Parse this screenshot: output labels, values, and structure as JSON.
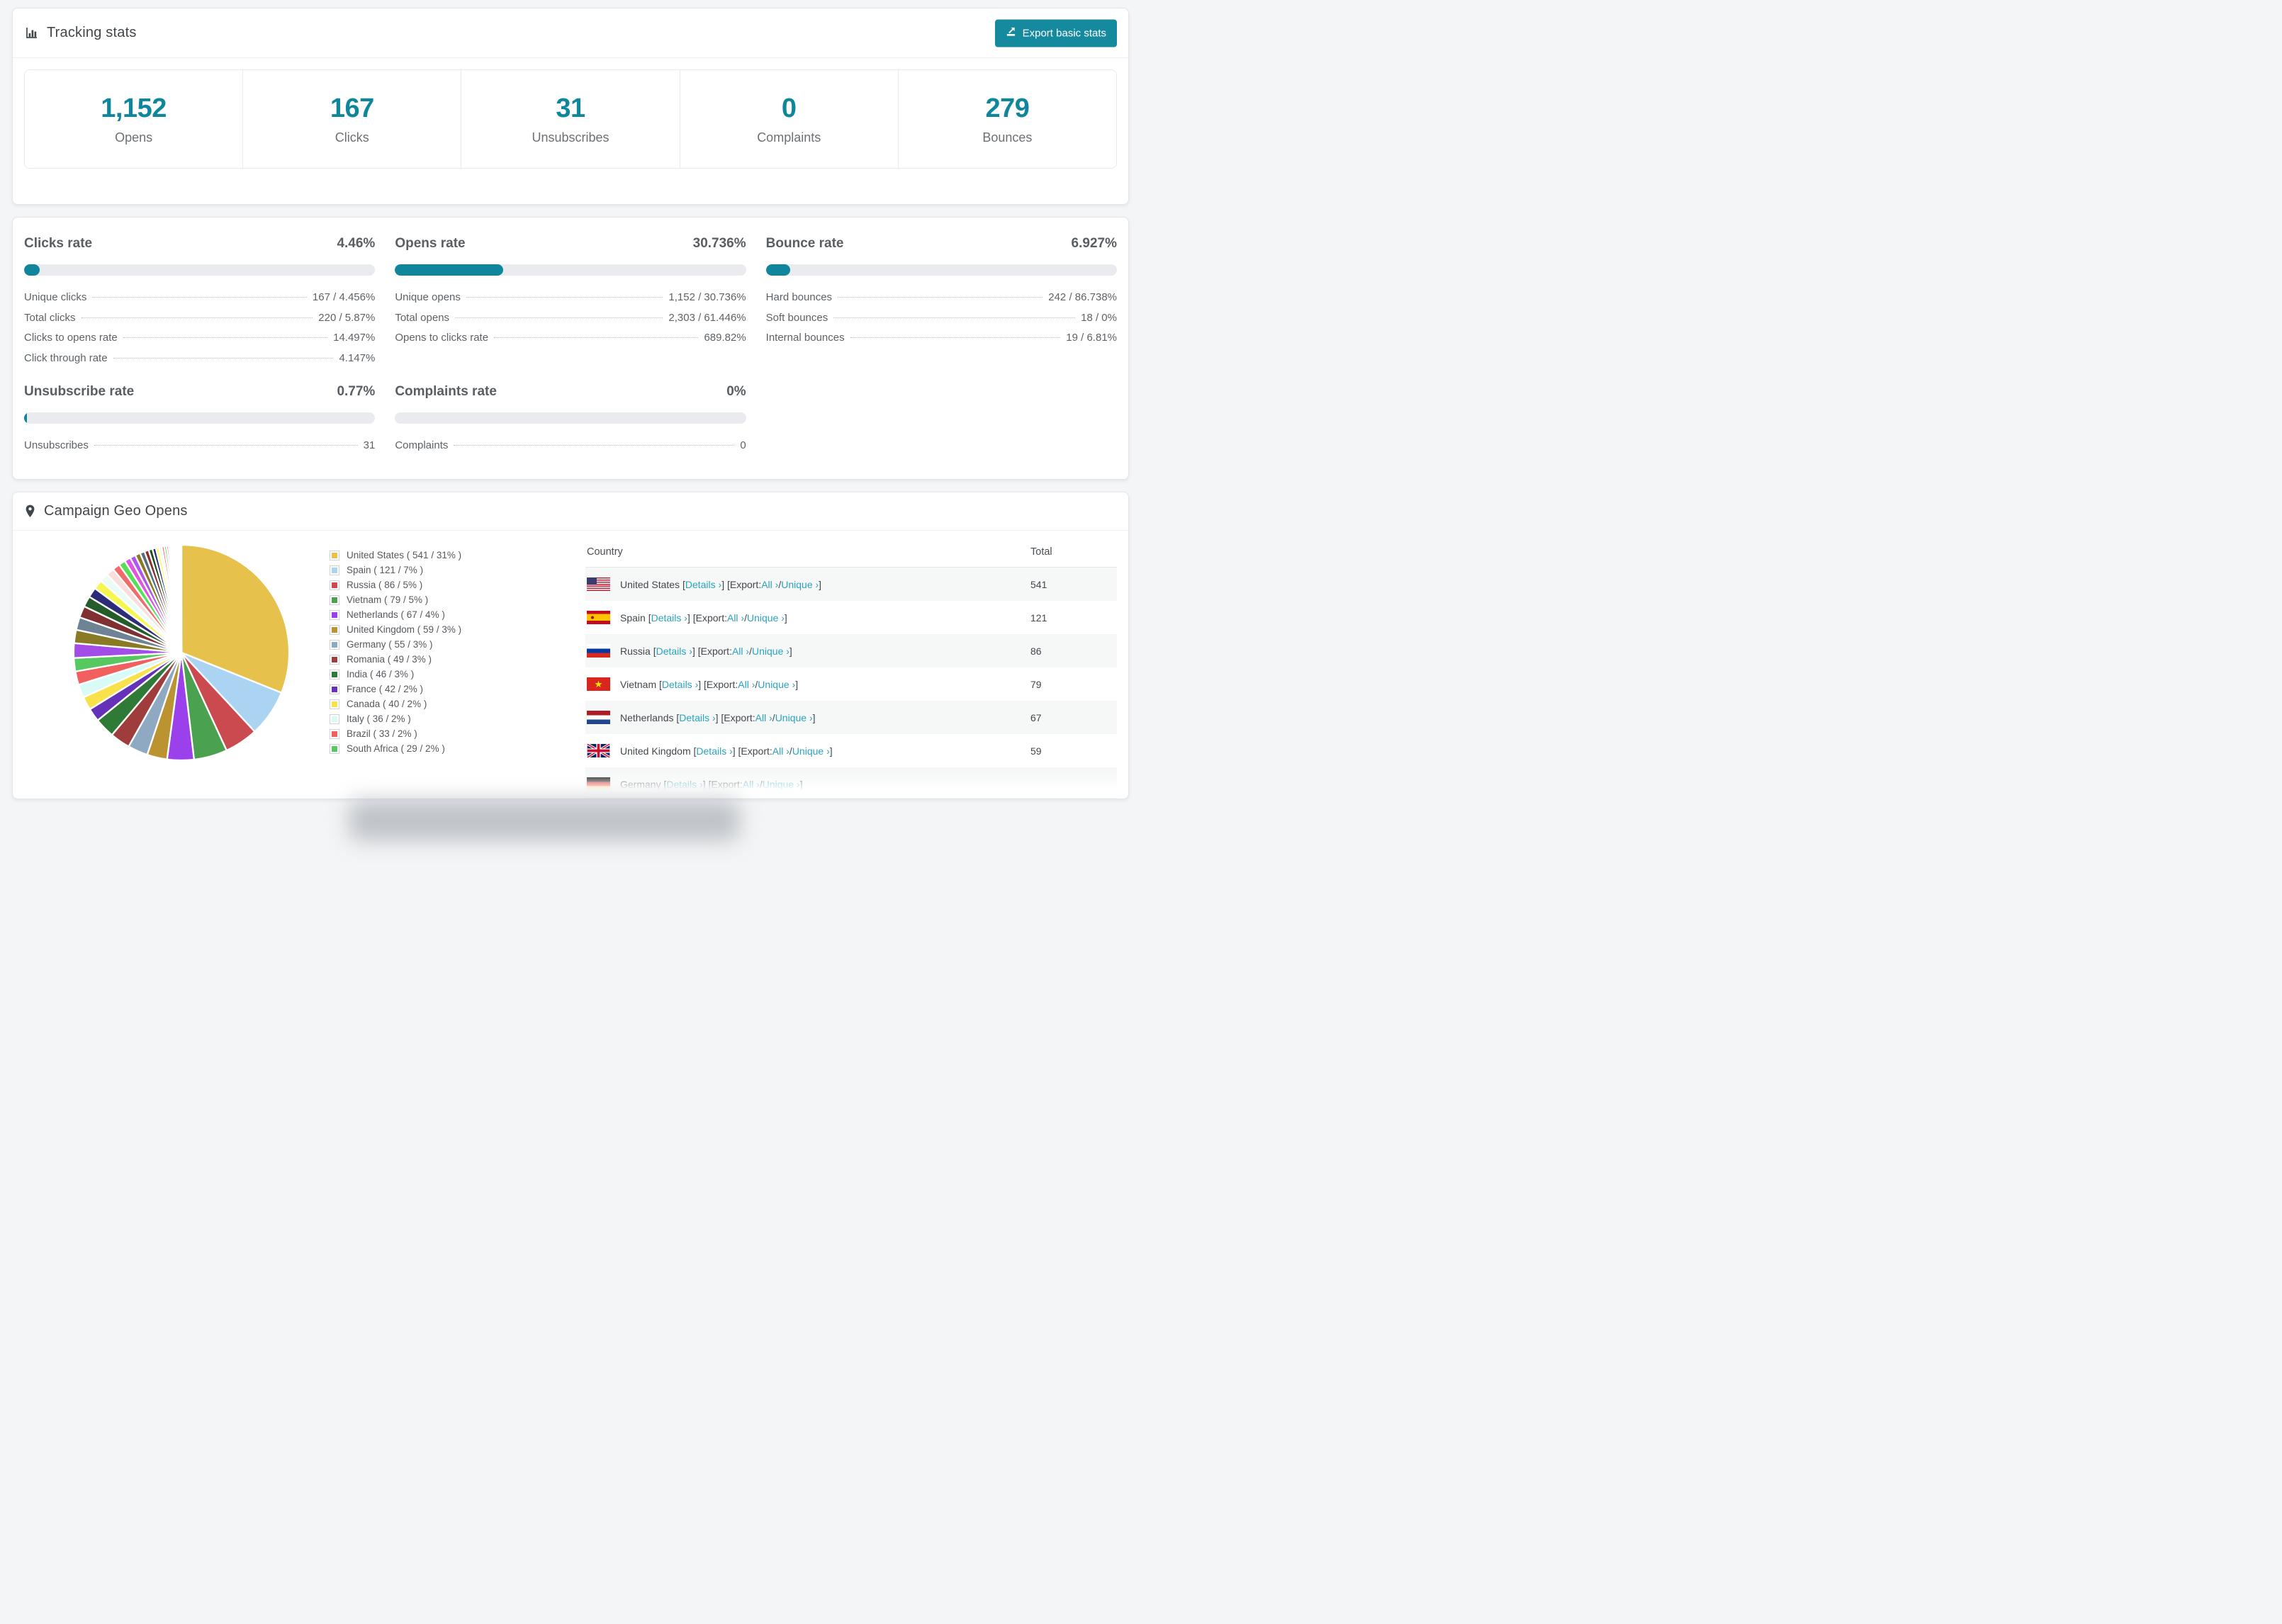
{
  "tracking": {
    "title": "Tracking stats",
    "export_label": "Export basic stats",
    "stats": [
      {
        "value": "1,152",
        "label": "Opens"
      },
      {
        "value": "167",
        "label": "Clicks"
      },
      {
        "value": "31",
        "label": "Unsubscribes"
      },
      {
        "value": "0",
        "label": "Complaints"
      },
      {
        "value": "279",
        "label": "Bounces"
      }
    ]
  },
  "rates": [
    {
      "key": "clicks",
      "title": "Clicks rate",
      "value": "4.46%",
      "percent": 4.46,
      "rows": [
        {
          "label": "Unique clicks",
          "value": "167 / 4.456%"
        },
        {
          "label": "Total clicks",
          "value": "220 / 5.87%"
        },
        {
          "label": "Clicks to opens rate",
          "value": "14.497%"
        },
        {
          "label": "Click through rate",
          "value": "4.147%"
        }
      ]
    },
    {
      "key": "opens",
      "title": "Opens rate",
      "value": "30.736%",
      "percent": 30.736,
      "rows": [
        {
          "label": "Unique opens",
          "value": "1,152 / 30.736%"
        },
        {
          "label": "Total opens",
          "value": "2,303 / 61.446%"
        },
        {
          "label": "Opens to clicks rate",
          "value": "689.82%"
        }
      ]
    },
    {
      "key": "bounce",
      "title": "Bounce rate",
      "value": "6.927%",
      "percent": 6.927,
      "rows": [
        {
          "label": "Hard bounces",
          "value": "242 / 86.738%"
        },
        {
          "label": "Soft bounces",
          "value": "18 / 0%"
        },
        {
          "label": "Internal bounces",
          "value": "19 / 6.81%"
        }
      ]
    },
    {
      "key": "unsubscribe",
      "title": "Unsubscribe rate",
      "value": "0.77%",
      "percent": 0.77,
      "rows": [
        {
          "label": "Unsubscribes",
          "value": "31"
        }
      ]
    },
    {
      "key": "complaints",
      "title": "Complaints rate",
      "value": "0%",
      "percent": 0,
      "rows": [
        {
          "label": "Complaints",
          "value": "0"
        }
      ]
    }
  ],
  "geo": {
    "title": "Campaign Geo Opens",
    "table": {
      "columns": [
        "Country",
        "Total"
      ],
      "links": {
        "details": "Details ›",
        "all": "All ›",
        "unique": "Unique ›",
        "bracket_open": "[",
        "bracket_close": "]",
        "export_prefix": "] [Export: ",
        "slash": " / "
      },
      "rows": [
        {
          "country": "United States",
          "flag": "us",
          "total": "541",
          "partial": false
        },
        {
          "country": "Spain",
          "flag": "es",
          "total": "121",
          "partial": false
        },
        {
          "country": "Russia",
          "flag": "ru",
          "total": "86",
          "partial": false
        },
        {
          "country": "Vietnam",
          "flag": "vn",
          "total": "79",
          "partial": false
        },
        {
          "country": "Netherlands",
          "flag": "nl",
          "total": "67",
          "partial": false
        },
        {
          "country": "United Kingdom",
          "flag": "uk",
          "total": "59",
          "partial": false
        },
        {
          "country": "Germany",
          "flag": "de",
          "total": "",
          "partial": true
        }
      ]
    },
    "chart_data": {
      "type": "pie",
      "title": "Campaign Geo Opens",
      "legend_position": "right",
      "slices": [
        {
          "label": "United States",
          "count": 541,
          "pct": 31,
          "color": "#e6c14b"
        },
        {
          "label": "Spain",
          "count": 121,
          "pct": 7,
          "color": "#abd3f2"
        },
        {
          "label": "Russia",
          "count": 86,
          "pct": 5,
          "color": "#cb4a50"
        },
        {
          "label": "Vietnam",
          "count": 79,
          "pct": 5,
          "color": "#4aa14f"
        },
        {
          "label": "Netherlands",
          "count": 67,
          "pct": 4,
          "color": "#9b41eb"
        },
        {
          "label": "United Kingdom",
          "count": 59,
          "pct": 3,
          "color": "#bb9431"
        },
        {
          "label": "Germany",
          "count": 55,
          "pct": 3,
          "color": "#8fa9c2"
        },
        {
          "label": "Romania",
          "count": 49,
          "pct": 3,
          "color": "#9e3d3b"
        },
        {
          "label": "India",
          "count": 46,
          "pct": 3,
          "color": "#2f7a36"
        },
        {
          "label": "France",
          "count": 42,
          "pct": 2,
          "color": "#6531b8"
        },
        {
          "label": "Canada",
          "count": 40,
          "pct": 2,
          "color": "#f8e14b"
        },
        {
          "label": "Italy",
          "count": 36,
          "pct": 2,
          "color": "#d9fbf6"
        },
        {
          "label": "Brazil",
          "count": 33,
          "pct": 2,
          "color": "#f15f5f"
        },
        {
          "label": "South Africa",
          "count": 29,
          "pct": 2,
          "color": "#57c85f"
        }
      ],
      "unlabeled_small_slices": {
        "note": "many additional unlabeled countries, estimated percentages, drawn clockwise after South Africa",
        "pcts": [
          2.2,
          2.0,
          1.9,
          1.75,
          1.6,
          1.5,
          1.4,
          1.3,
          1.2,
          1.1,
          1.0,
          0.92,
          0.84,
          0.77,
          0.7,
          0.64,
          0.58,
          0.52,
          0.47,
          0.42,
          0.38,
          0.34,
          0.3,
          0.27,
          0.24,
          0.21,
          0.18,
          0.16,
          0.14,
          0.12,
          0.1,
          0.09,
          0.08,
          0.07,
          0.06,
          0.05,
          0.04,
          0.04,
          0.03,
          0.03
        ],
        "colors": [
          "#a34de8",
          "#8a7a25",
          "#6e8494",
          "#803030",
          "#245c2a",
          "#2c2c78",
          "#f6f64e",
          "#eafcf6",
          "#f9dede",
          "#f26b6b",
          "#55e055",
          "#e055e0",
          "#b055f0",
          "#8a7a25",
          "#54707e",
          "#8a3030",
          "#1e4c1e",
          "#24307a",
          "#ffff55",
          "#e8fcfa",
          "#ff7070",
          "#55d455",
          "#d855d8",
          "#d8a830",
          "#a8d0ea",
          "#d84848",
          "#3a9a40",
          "#8a40d0",
          "#c8a030",
          "#88a8c8",
          "#b03838",
          "#287030",
          "#6838b0",
          "#e8c840",
          "#b8e0f0",
          "#e85858",
          "#48b048",
          "#c048c0",
          "#a08020",
          "#506880"
        ]
      }
    }
  }
}
